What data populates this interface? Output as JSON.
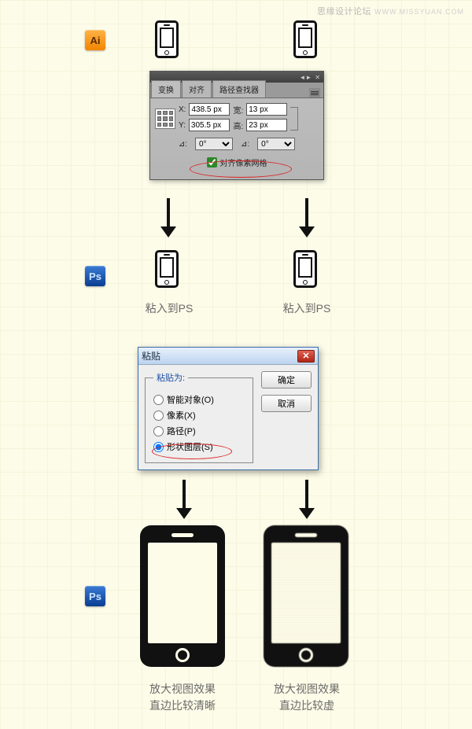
{
  "watermark": {
    "text": "思缘设计论坛",
    "url": "WWW.MISSYUAN.COM"
  },
  "app_labels": {
    "ai": "Ai",
    "ps": "Ps"
  },
  "panel": {
    "tabs": [
      "变换",
      "对齐",
      "路径查找器"
    ],
    "labels": {
      "x": "X:",
      "y": "Y:",
      "w": "宽:",
      "h": "高:",
      "angle": "⊿:",
      "shear": "⊿:"
    },
    "x": "438.5 px",
    "y": "305.5 px",
    "w": "13 px",
    "h": "23 px",
    "angle": "0°",
    "shear": "0°",
    "checkbox": "对齐像素网格"
  },
  "captions": {
    "paste_ps_left": "粘入到PS",
    "paste_ps_right": "粘入到PS",
    "bottom_left": "放大视图效果\n直边比较清晰",
    "bottom_right": "放大视图效果\n直边比较虚"
  },
  "dialog": {
    "title": "粘贴",
    "legend": "粘贴为:",
    "options": [
      "智能对象(O)",
      "像素(X)",
      "路径(P)",
      "形状图层(S)"
    ],
    "ok": "确定",
    "cancel": "取消",
    "close": "✕"
  }
}
